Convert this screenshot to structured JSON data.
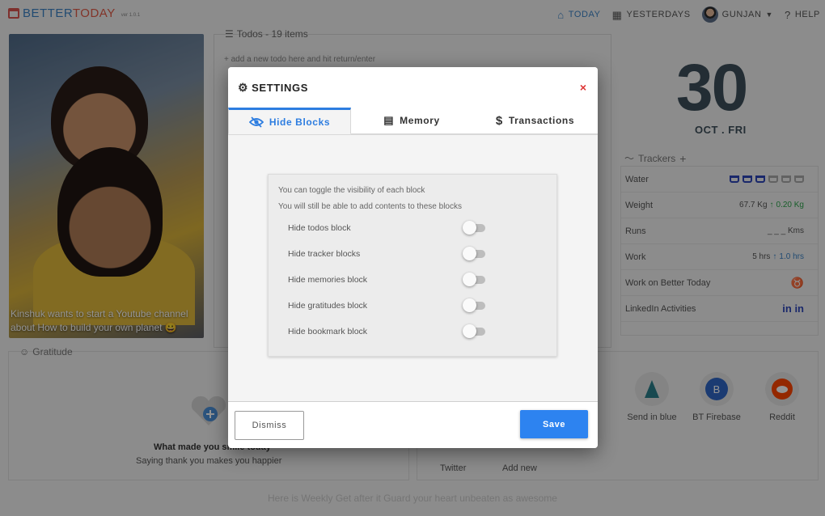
{
  "app": {
    "logo_better": "BETTER",
    "logo_today": "TODAY",
    "version": "ver 1.0.1"
  },
  "nav": {
    "today": "TODAY",
    "yesterdays": "YESTERDAYS",
    "user": "GUNJAN",
    "help": "HELP"
  },
  "photo": {
    "caption": "Kinshuk wants to start a Youtube channel about How to build your own planet 😀"
  },
  "todos": {
    "header": "Todos - 19 items",
    "placeholder": "+ add a new todo here and hit return/enter"
  },
  "date": {
    "day": "30",
    "month_weekday": "OCT . FRI"
  },
  "trackers": {
    "header": "Trackers",
    "rows": [
      {
        "label": "Water",
        "value": ""
      },
      {
        "label": "Weight",
        "value": "67.7 Kg",
        "delta": "0.20 Kg"
      },
      {
        "label": "Runs",
        "value": "_ _ _ Kms"
      },
      {
        "label": "Work",
        "value": "5 hrs",
        "delta": "1.0 hrs"
      },
      {
        "label": "Work on Better Today",
        "value": ""
      },
      {
        "label": "LinkedIn Activities",
        "value": "in in"
      }
    ],
    "water_glasses_filled": 3,
    "water_glasses_total": 6
  },
  "gratitude": {
    "header": "Gratitude",
    "question": "What made you smile today",
    "subtitle": "Saying thank you makes you happier"
  },
  "bookmarks": {
    "items": [
      {
        "label": "Send in blue"
      },
      {
        "label": "BT Firebase",
        "letter": "B"
      },
      {
        "label": "Reddit"
      }
    ],
    "twitter": "Twitter",
    "add_new": "Add new"
  },
  "footer": {
    "quote": "Here is Weekly Get after it Guard your heart unbeaten as awesome"
  },
  "modal": {
    "title": "SETTINGS",
    "close": "×",
    "tabs": [
      {
        "label": "Hide Blocks",
        "icon": "eye-slash-icon"
      },
      {
        "label": "Memory",
        "icon": "calculator-icon"
      },
      {
        "label": "Transactions",
        "icon": "dollar-icon"
      }
    ],
    "intro_1": "You can toggle the visibility of each block",
    "intro_2": "You will still be able to add contents to these blocks",
    "toggles": [
      {
        "label": "Hide todos block",
        "on": false
      },
      {
        "label": "Hide tracker blocks",
        "on": false
      },
      {
        "label": "Hide memories block",
        "on": false
      },
      {
        "label": "Hide gratitudes block",
        "on": false
      },
      {
        "label": "Hide bookmark block",
        "on": false
      }
    ],
    "dismiss": "Dismiss",
    "save": "Save"
  },
  "colors": {
    "accent": "#2d83f0",
    "close": "#dd3333",
    "date": "#3d4f5a"
  }
}
